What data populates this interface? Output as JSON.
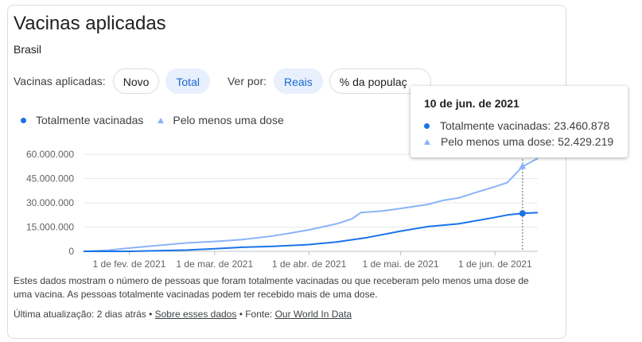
{
  "header": {
    "title": "Vacinas aplicadas",
    "subtitle": "Brasil"
  },
  "controls": {
    "vacinas_label": "Vacinas aplicadas:",
    "novo": "Novo",
    "total": "Total",
    "ver_por_label": "Ver por:",
    "reais": "Reais",
    "pct_pop": "% da populaç"
  },
  "legend": {
    "full": "Totalmente vacinadas",
    "one_dose": "Pelo menos uma dose"
  },
  "tooltip": {
    "date": "10 de jun. de 2021",
    "full_text": "Totalmente vacinadas: 23.460.878",
    "one_text": "Pelo menos uma dose: 52.429.219"
  },
  "note": "Estes dados mostram o número de pessoas que foram totalmente vacinadas ou que receberam pelo menos uma dose de uma vacina. As pessoas totalmente vacinadas podem ter recebido mais de uma dose.",
  "footer": {
    "updated": "Última atualização: 2 dias atrás",
    "sep": " • ",
    "about": "Sobre esses dados",
    "source_label": " • Fonte: ",
    "source": "Our World In Data"
  },
  "colors": {
    "full": "#1a73e8",
    "one_dose": "#8ab4f8",
    "grid": "#e8eaed",
    "axis": "#5f6368"
  },
  "chart_data": {
    "type": "line",
    "x_start": "2021-01-17",
    "x_end": "2021-06-15",
    "ylim": [
      0,
      60000000
    ],
    "yticks": [
      {
        "value": 0,
        "label": "0"
      },
      {
        "value": 15000000,
        "label": "15.000.000"
      },
      {
        "value": 30000000,
        "label": "30.000.000"
      },
      {
        "value": 45000000,
        "label": "45.000.000"
      },
      {
        "value": 60000000,
        "label": "60.000.000"
      }
    ],
    "xticks": [
      {
        "date": "2021-02-01",
        "label": "1 de fev. de 2021"
      },
      {
        "date": "2021-03-01",
        "label": "1 de mar. de 2021"
      },
      {
        "date": "2021-04-01",
        "label": "1 de abr. de 2021"
      },
      {
        "date": "2021-05-01",
        "label": "1 de mai. de 2021"
      },
      {
        "date": "2021-06-01",
        "label": "1 de jun. de 2021"
      }
    ],
    "highlight": {
      "date": "2021-06-10"
    },
    "series": [
      {
        "name": "Pelo menos uma dose",
        "key": "one_dose",
        "points": [
          [
            "2021-01-17",
            0
          ],
          [
            "2021-01-25",
            700000
          ],
          [
            "2021-02-01",
            2000000
          ],
          [
            "2021-02-10",
            3600000
          ],
          [
            "2021-02-20",
            5200000
          ],
          [
            "2021-03-01",
            6100000
          ],
          [
            "2021-03-10",
            7300000
          ],
          [
            "2021-03-20",
            9500000
          ],
          [
            "2021-03-25",
            11000000
          ],
          [
            "2021-04-01",
            13300000
          ],
          [
            "2021-04-10",
            17000000
          ],
          [
            "2021-04-15",
            20000000
          ],
          [
            "2021-04-18",
            24000000
          ],
          [
            "2021-04-25",
            25000000
          ],
          [
            "2021-05-01",
            26500000
          ],
          [
            "2021-05-10",
            29000000
          ],
          [
            "2021-05-15",
            31500000
          ],
          [
            "2021-05-20",
            33000000
          ],
          [
            "2021-05-25",
            36000000
          ],
          [
            "2021-06-01",
            40000000
          ],
          [
            "2021-06-05",
            42500000
          ],
          [
            "2021-06-10",
            52429219
          ],
          [
            "2021-06-15",
            57500000
          ]
        ]
      },
      {
        "name": "Totalmente vacinadas",
        "key": "full",
        "points": [
          [
            "2021-01-17",
            0
          ],
          [
            "2021-01-25",
            0
          ],
          [
            "2021-02-01",
            0
          ],
          [
            "2021-02-10",
            400000
          ],
          [
            "2021-02-20",
            800000
          ],
          [
            "2021-03-01",
            1600000
          ],
          [
            "2021-03-10",
            2500000
          ],
          [
            "2021-03-20",
            3100000
          ],
          [
            "2021-04-01",
            4200000
          ],
          [
            "2021-04-10",
            5800000
          ],
          [
            "2021-04-20",
            8500000
          ],
          [
            "2021-05-01",
            12500000
          ],
          [
            "2021-05-10",
            15300000
          ],
          [
            "2021-05-20",
            17000000
          ],
          [
            "2021-06-01",
            21000000
          ],
          [
            "2021-06-05",
            22500000
          ],
          [
            "2021-06-10",
            23460878
          ],
          [
            "2021-06-15",
            24000000
          ]
        ]
      }
    ]
  }
}
